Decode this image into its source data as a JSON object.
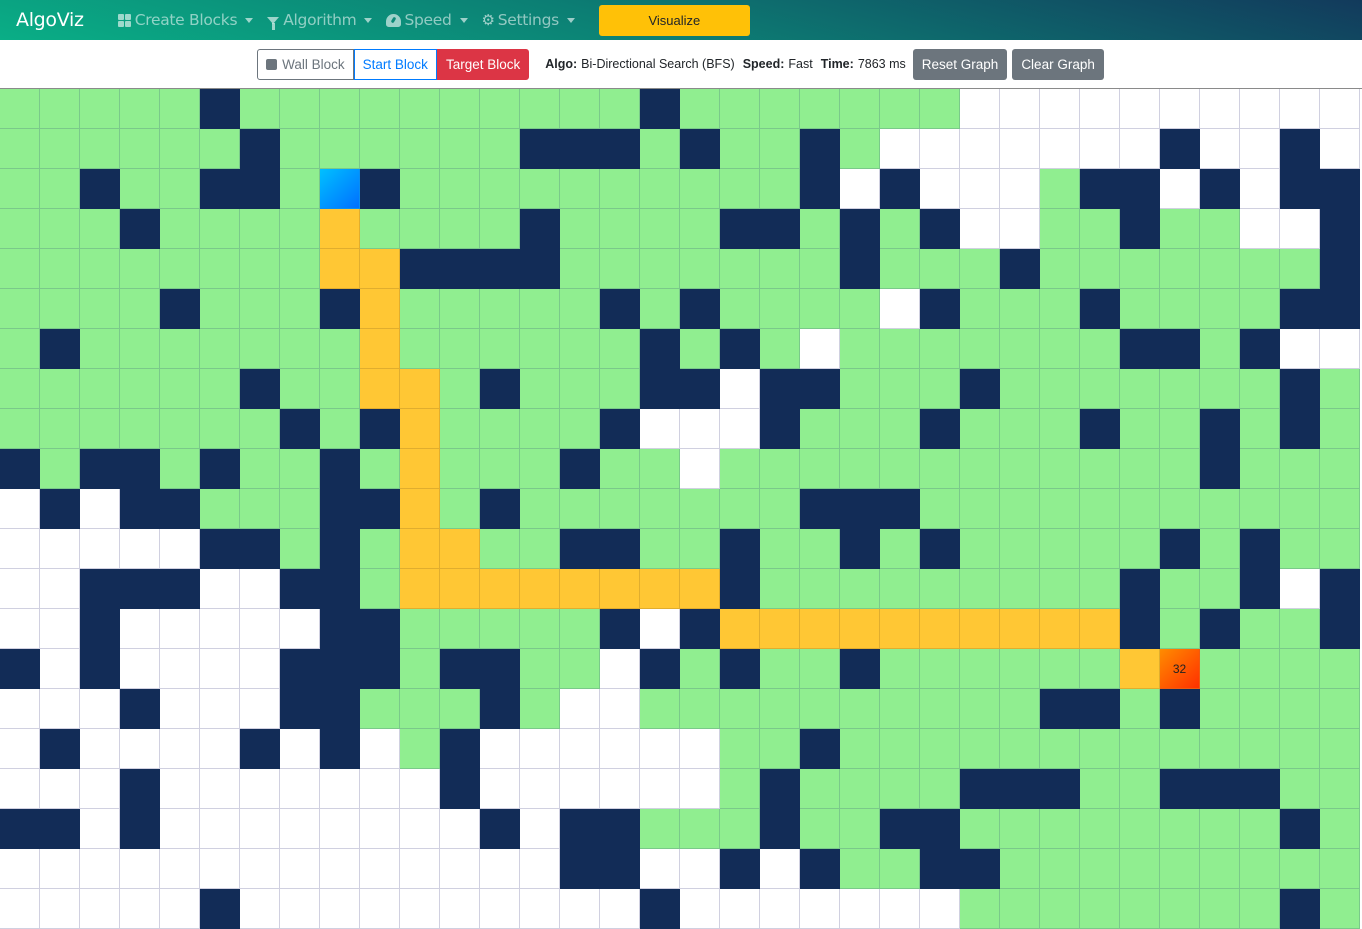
{
  "navbar": {
    "brand": "AlgoViz",
    "menus": [
      {
        "label": "Create Blocks",
        "icon": "th-large-icon"
      },
      {
        "label": "Algorithm",
        "icon": "filter-icon"
      },
      {
        "label": "Speed",
        "icon": "tachometer-icon"
      },
      {
        "label": "Settings",
        "icon": "gear-icon"
      }
    ],
    "visualize_label": "Visualize"
  },
  "toolbar": {
    "wall_block_label": "Wall Block",
    "start_block_label": "Start Block",
    "target_block_label": "Target Block",
    "algo_label": "Algo:",
    "algo_value": "Bi-Directional Search (BFS)",
    "speed_label": "Speed:",
    "speed_value": "Fast",
    "time_label": "Time:",
    "time_value": "7863 ms",
    "reset_label": "Reset Graph",
    "clear_label": "Clear Graph"
  },
  "colors": {
    "visited": "#90ee90",
    "wall": "#122c57",
    "path": "#ffc734",
    "start": "#0090ff",
    "target": "#ff5a00",
    "empty": "#ffffff",
    "visualize": "#ffc107",
    "target_button": "#dc3545",
    "start_button": "#007bff"
  },
  "grid": {
    "legend": {
      ".": "empty",
      "v": "visited",
      "#": "wall",
      "p": "path",
      "S": "start",
      "T": "target"
    },
    "target_label": "32",
    "rows": [
      "vvvvv#vvvvvvvvvv#vvvvvvv..........",
      "vvvvvv#vvvvvv###v#vv#v.......#..#.",
      "vv#vv##vS#vvvvvvvvvv#.#...v##.#.##",
      "vvv#vvvvpvvvv#vvvv##v#v#..vv#vv..#.",
      "vvvvvvvvpp####vvvvvvv#vvv#vvvvvvv#..",
      "vvvv#vvv#pvvvvv#v#vvvv.#vvv#vvvv##",
      "v#vvvvvvvpvvvvvv#v#v.vvvvvvv##v#",
      "vvvvvv#vvppv#vvv##.##vvv#vvvvvvv#vv",
      "vvvvvvv#v#pvvvv#...#vvv#vvv#vv#v#v",
      "#v##v#vv#vpvvv#vv.vvvvvvvvvvvv#vvv",
      ".#.##vvv##pv#vvvvvvv###vvvvvvvvvvv",
      ".....##v#vppvv##vv#vv#v#vvvvv#v#vv",
      "..###..##vpppppppp#vvvvvvvvv#vv#.#vv",
      "..#.....##vvvvv#.#pppppppppp#v#vv#",
      "#.#....###v##vv.#v#vv#vvvvvvpTvvvvv",
      "...#...##vvv#v..vvvvvvvvvv##v#vvvvv",
      ".#....#.#.v#......vv#vvvvvvvvvvvvvv",
      "...#.......#......v#vvvv###vv###vv",
      "##.#........#.##vvv#vv##vvvvvvvv#v",
      "..............##..#.#vv##vvvvvvvvvv",
      ".....#..........#.......vvvvvvvv#v"
    ]
  }
}
